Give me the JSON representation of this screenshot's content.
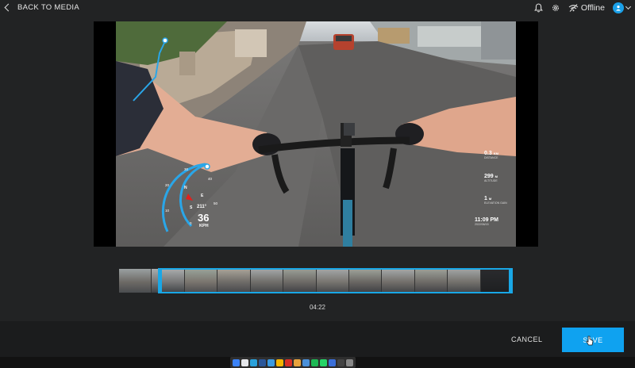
{
  "header": {
    "back_label": "BACK TO MEDIA",
    "status": "Offline",
    "icons": [
      "chevron-left-icon",
      "bell-icon",
      "gear-icon",
      "offline-signal-icon",
      "user-icon",
      "chevron-down-icon"
    ]
  },
  "video": {
    "overlay": {
      "speed_value": "36",
      "speed_unit": "KPH",
      "heading": "211°",
      "compass_n": "N",
      "compass_s": "S",
      "compass_e": "E",
      "gauge_ticks": [
        "0",
        "10",
        "20",
        "30",
        "40",
        "50"
      ],
      "stats": [
        {
          "value": "0.3",
          "unit": "KM",
          "label": "DISTANCE"
        },
        {
          "value": "299",
          "unit": "M",
          "label": "ALTITUDE"
        },
        {
          "value": "1",
          "unit": "M",
          "label": "ELEVATION GAIN"
        },
        {
          "value": "11:09 PM",
          "unit": "",
          "label": "2022/06/15"
        }
      ]
    }
  },
  "timeline": {
    "timecode": "04:22",
    "thumbnail_count": 12,
    "selection_start_fraction": 0.1,
    "selection_end_fraction": 1.0
  },
  "footer": {
    "cancel_label": "CANCEL",
    "save_label": "SAVE"
  },
  "colors": {
    "accent": "#0fa2f0",
    "background": "#222324",
    "footer": "#1b1c1d"
  },
  "taskbar": {
    "apps": [
      "finder-icon",
      "safari-icon",
      "telegram-icon",
      "word-icon",
      "vscode-icon",
      "charts-icon",
      "pdf-icon",
      "chrome-icon",
      "mail-icon",
      "spotify-icon",
      "whatsapp-icon",
      "vpn-icon",
      "terminal-icon",
      "trash-icon"
    ]
  }
}
